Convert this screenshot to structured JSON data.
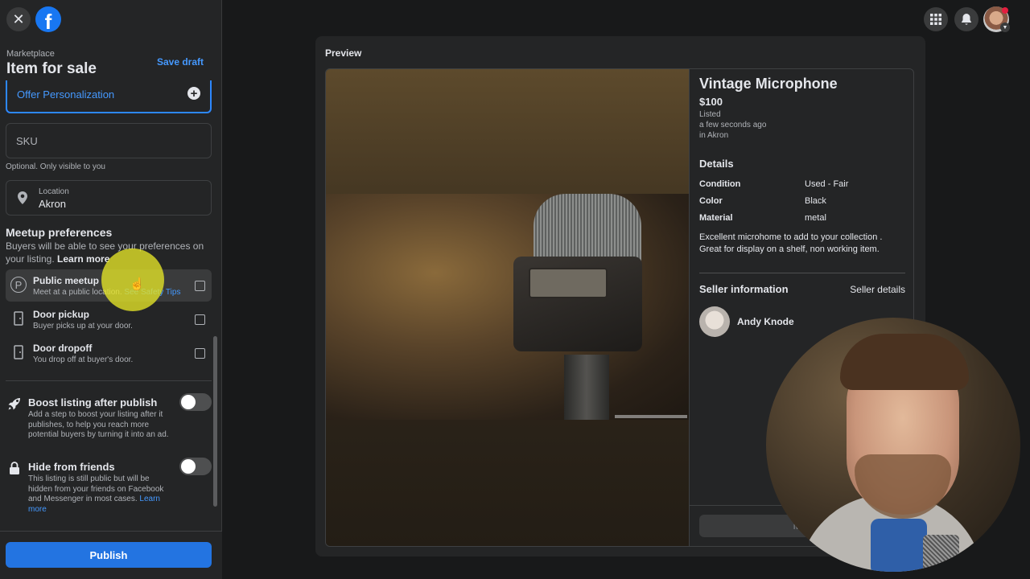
{
  "sidebar": {
    "breadcrumb": "Marketplace",
    "title": "Item for sale",
    "save_draft": "Save draft",
    "offer_personalization": "Offer Personalization",
    "sku_placeholder": "SKU",
    "sku_hint": "Optional. Only visible to you",
    "location_label": "Location",
    "location_value": "Akron",
    "meetup": {
      "title": "Meetup preferences",
      "desc": "Buyers will be able to see your preferences on your listing.",
      "learn_more": "Learn more",
      "options": [
        {
          "title": "Public meetup",
          "sub": "Meet at a public location.",
          "link": "See Safety Tips",
          "icon": "P"
        },
        {
          "title": "Door pickup",
          "sub": "Buyer picks up at your door.",
          "icon": "door"
        },
        {
          "title": "Door dropoff",
          "sub": "You drop off at buyer's door.",
          "icon": "door"
        }
      ]
    },
    "boost": {
      "title": "Boost listing after publish",
      "desc": "Add a step to boost your listing after it publishes, to help you reach more potential buyers by turning it into an ad."
    },
    "hide": {
      "title": "Hide from friends",
      "desc": "This listing is still public but will be hidden from your friends on Facebook and Messenger in most cases.",
      "learn_more": "Learn more"
    },
    "publish": "Publish"
  },
  "preview": {
    "label": "Preview",
    "item_title": "Vintage Microphone",
    "price": "$100",
    "listed": "Listed",
    "listed_time": "a few seconds ago",
    "listed_place": "in Akron",
    "details_title": "Details",
    "details": [
      {
        "key": "Condition",
        "value": "Used - Fair"
      },
      {
        "key": "Color",
        "value": "Black"
      },
      {
        "key": "Material",
        "value": "metal"
      }
    ],
    "description": "Excellent microhome to add to your collection . Great for display on a shelf, non working item.",
    "seller_title": "Seller information",
    "seller_details": "Seller details",
    "seller_name": "Andy Knode",
    "message_button": "Mes"
  },
  "colors": {
    "accent": "#2374e1",
    "link": "#4599ff",
    "surface": "#242526",
    "background": "#18191a"
  },
  "icons": {
    "close": "close-icon",
    "logo": "facebook-logo-icon",
    "plus": "plus-circle-icon",
    "location": "map-pin-icon",
    "menu": "grid-menu-icon",
    "notifications": "bell-icon"
  }
}
